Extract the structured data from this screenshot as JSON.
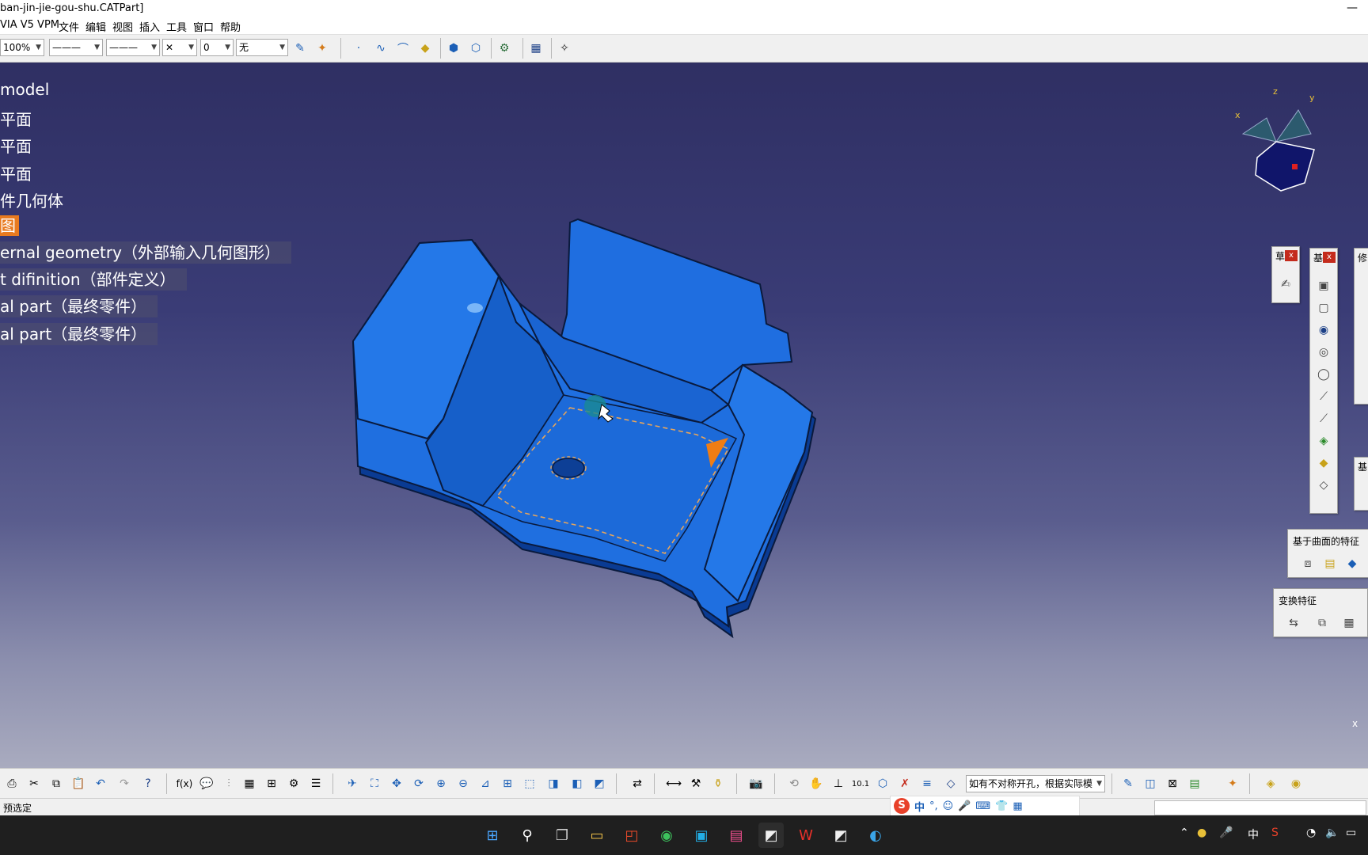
{
  "window": {
    "title": "ban-jin-jie-gou-shu.CATPart]",
    "close_glyph": "✕",
    "min_glyph": "—"
  },
  "menu": [
    {
      "label": "VIA V5 VPM"
    },
    {
      "label": "文件"
    },
    {
      "label": "编辑"
    },
    {
      "label": "视图"
    },
    {
      "label": "插入"
    },
    {
      "label": "工具"
    },
    {
      "label": "窗口"
    },
    {
      "label": "帮助"
    }
  ],
  "toolbar": {
    "zoom_value": "100%",
    "line_type": "———",
    "line_weight": "———",
    "point_style": "✕",
    "layer": "0",
    "render_style": "无"
  },
  "tree": [
    {
      "label": "model"
    },
    {
      "label": "平面"
    },
    {
      "label": "平面"
    },
    {
      "label": "平面"
    },
    {
      "label": "件几何体"
    },
    {
      "label": "图"
    },
    {
      "label": "ernal geometry（外部输入几何图形）"
    },
    {
      "label": "t difinition（部件定义）"
    },
    {
      "label": "al part（最终零件）"
    },
    {
      "label": "al part（最终零件）"
    }
  ],
  "compass": {
    "x": "x",
    "y": "y",
    "z": "z"
  },
  "panels": {
    "p1_title": "草",
    "p2_title": "基",
    "p3_title": "修",
    "p4_title": "基",
    "surface_features": "基于曲面的特征",
    "transform_features": "变换特征"
  },
  "bottom_toolbar": {
    "search_text": "如有不对称开孔，根据实际模",
    "fx_label": "f(x)"
  },
  "ime": {
    "lang": "中",
    "punct": "°,"
  },
  "status": {
    "text": "预选定"
  },
  "tray": {
    "lang": "中"
  },
  "axis_label": "x"
}
